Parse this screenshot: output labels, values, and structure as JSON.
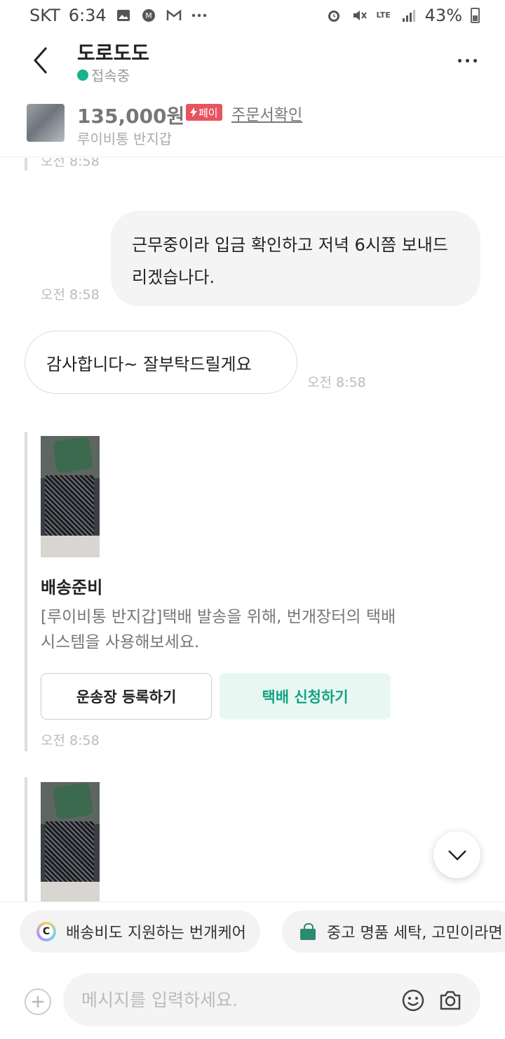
{
  "status_bar": {
    "carrier": "SKT",
    "time": "6:34",
    "network": "LTE",
    "battery": "43%"
  },
  "header": {
    "seller_name": "도로도도",
    "online_status": "접속중"
  },
  "product": {
    "price": "135,000원",
    "pay_badge": "페이",
    "order_link": "주문서확인",
    "name": "루이비통 반지갑"
  },
  "messages": {
    "partial_timestamp": "오전 8:58",
    "outgoing": {
      "text": "근무중이라 입금 확인하고 저녁 6시쯤 보내드리겠습나다.",
      "timestamp": "오전 8:58"
    },
    "incoming": {
      "text": "감사합니다~ 잘부탁드릴게요",
      "timestamp": "오전 8:58"
    }
  },
  "shipping_card": {
    "title": "배송준비",
    "description": "[루이비통 반지갑]택배 발송을 위해, 번개장터의 택배 시스템을 사용해보세요.",
    "register_button": "운송장 등록하기",
    "request_button": "택배 신청하기",
    "timestamp": "오전 8:58"
  },
  "promos": [
    {
      "label": "배송비도 지원하는 번개케어",
      "icon": "bungae-care-c-icon"
    },
    {
      "label": "중고 명품 세탁, 고민이라면",
      "icon": "shopping-bag-icon"
    }
  ],
  "composer": {
    "placeholder": "메시지를 입력하세요."
  },
  "colors": {
    "online": "#19b28a",
    "pay_badge": "#e8535f",
    "mint_text": "#14a383",
    "mint_bg": "#e9f7f3"
  }
}
